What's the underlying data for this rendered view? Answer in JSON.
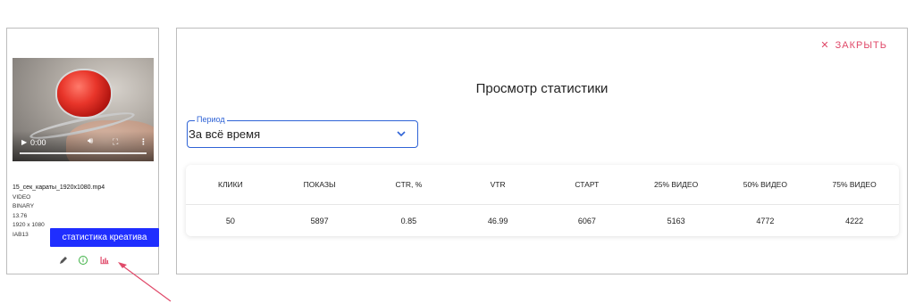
{
  "creative": {
    "video": {
      "time": "0:00"
    },
    "file_name": "15_сек_караты_1920х1080.mp4",
    "type": "VIDEO",
    "format": "BINARY",
    "duration": "13.76",
    "resolution": "1920 x 1080",
    "code": "IAB13",
    "stats_button_label": "статистика креатива",
    "icons": {
      "edit": "pencil-icon",
      "info": "info-icon",
      "stats": "bar-chart-icon"
    }
  },
  "panel": {
    "close_label": "ЗАКРЫТЬ",
    "title": "Просмотр статистики",
    "period": {
      "label": "Период",
      "value": "За всё время"
    },
    "table": {
      "headers": [
        "КЛИКИ",
        "ПОКАЗЫ",
        "CTR, %",
        "VTR",
        "СТАРТ",
        "25% ВИДЕО",
        "50% ВИДЕО",
        "75% ВИДЕО"
      ],
      "values": [
        "50",
        "5897",
        "0.85",
        "46.99",
        "6067",
        "5163",
        "4772",
        "4222"
      ]
    }
  },
  "colors": {
    "accent_blue": "#1f2eff",
    "close_red": "#e04a6a",
    "period_border": "#2f63d6",
    "arrow": "#e04a6a"
  }
}
